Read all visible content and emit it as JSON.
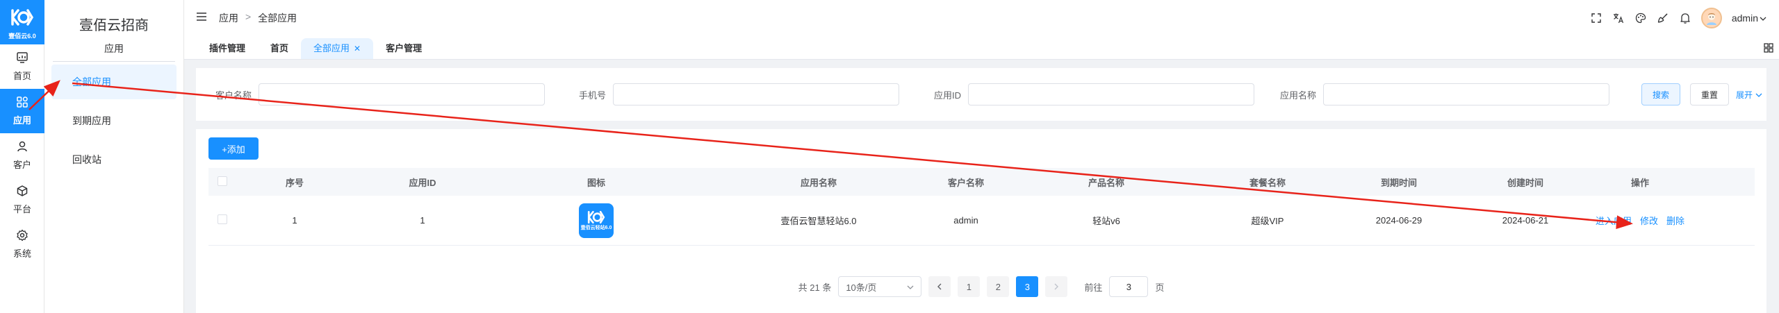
{
  "app": {
    "logo_text": "壹佰云6.0",
    "brand_name": "壹佰云招商"
  },
  "rail": {
    "items": [
      {
        "label": "首页",
        "icon": "dashboard-icon"
      },
      {
        "label": "应用",
        "icon": "apps-grid-icon",
        "active": true
      },
      {
        "label": "客户",
        "icon": "user-icon"
      },
      {
        "label": "平台",
        "icon": "cube-icon"
      },
      {
        "label": "系统",
        "icon": "gear-icon"
      }
    ]
  },
  "submenu": {
    "title": "应用",
    "items": [
      {
        "label": "全部应用",
        "active": true
      },
      {
        "label": "到期应用"
      },
      {
        "label": "回收站"
      }
    ]
  },
  "header": {
    "breadcrumb": [
      "应用",
      "全部应用"
    ],
    "breadcrumb_sep": ">",
    "user_name": "admin",
    "icons": [
      "fullscreen-icon",
      "translate-icon",
      "palette-icon",
      "brush-icon",
      "bell-icon"
    ]
  },
  "tabs": [
    {
      "label": "插件管理"
    },
    {
      "label": "首页"
    },
    {
      "label": "全部应用",
      "active": true,
      "closable": true
    },
    {
      "label": "客户管理"
    }
  ],
  "search": {
    "fields": [
      {
        "label": "客户名称",
        "value": ""
      },
      {
        "label": "手机号",
        "value": ""
      },
      {
        "label": "应用ID",
        "value": ""
      },
      {
        "label": "应用名称",
        "value": ""
      }
    ],
    "search_label": "搜索",
    "reset_label": "重置",
    "expand_label": "展开"
  },
  "table": {
    "add_label": "+添加",
    "columns": [
      "序号",
      "应用ID",
      "图标",
      "应用名称",
      "客户名称",
      "产品名称",
      "套餐名称",
      "到期时间",
      "创建时间",
      "操作"
    ],
    "rows": [
      {
        "index": "1",
        "app_id": "1",
        "icon_text": "壹佰云轻站6.0",
        "app_name": "壹佰云智慧轻站6.0",
        "customer": "admin",
        "product": "轻站v6",
        "plan": "超级VIP",
        "expire": "2024-06-29",
        "created": "2024-06-21",
        "actions": [
          "进入应用",
          "修改",
          "删除"
        ]
      }
    ]
  },
  "pagination": {
    "total_text": "共 21 条",
    "page_size": "10条/页",
    "pages": [
      "1",
      "2",
      "3"
    ],
    "current": "3",
    "goto_label": "前往",
    "goto_value": "3",
    "page_unit": "页"
  },
  "colors": {
    "primary": "#1890ff",
    "annotation": "#e8231a"
  }
}
